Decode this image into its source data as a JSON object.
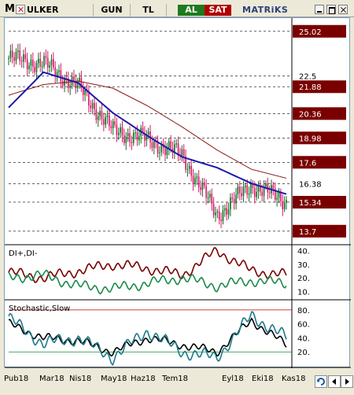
{
  "toolbar": {
    "symbol_prefix": "M",
    "symbol": "ULKER",
    "period": "GUN",
    "currency": "TL",
    "buy_label": "AL",
    "sell_label": "SAT",
    "brand": "MATRiKS"
  },
  "colors": {
    "price_tag_bg": "#7a0000",
    "candle_up": "#0a6e1e",
    "candle_down": "#e0106a",
    "ma_short": "#1a1aa8",
    "ma_long": "#8b1a1a",
    "di_plus": "#7a0000",
    "di_minus": "#1a8a4a",
    "stoch_k": "#1a7a8a",
    "stoch_d": "#000000",
    "buy": "#1e7a1e",
    "sell": "#b00000"
  },
  "price_panel": {
    "levels": [
      {
        "label": "25.02",
        "tag": true
      },
      {
        "label": "22.5",
        "tag": false
      },
      {
        "label": "21.88",
        "tag": true
      },
      {
        "label": "20.36",
        "tag": true
      },
      {
        "label": "18.98",
        "tag": true
      },
      {
        "label": "17.6",
        "tag": true
      },
      {
        "label": "16.38",
        "tag": false
      },
      {
        "label": "15.34",
        "tag": true
      },
      {
        "label": "13.7",
        "tag": true
      }
    ]
  },
  "di_panel": {
    "title": "DI+,DI-",
    "ticks": [
      "40.",
      "30.",
      "20.",
      "10."
    ]
  },
  "stoch_panel": {
    "title": "Stochastic,Slow",
    "ticks": [
      "80.",
      "60.",
      "40.",
      "20."
    ]
  },
  "x_axis": {
    "labels": [
      "Pub18",
      "Mar18",
      "Nis18",
      "May18",
      "Haz18",
      "Tem18",
      "Eyl18",
      "Eki18",
      "Kas18"
    ]
  },
  "chart_data": [
    {
      "type": "line",
      "panel": "price",
      "ylim": [
        13.2,
        25.5
      ],
      "x": [
        "Pub18",
        "Mar18",
        "Nis18",
        "May18",
        "Haz18",
        "Tem18",
        "Eyl18",
        "Eki18",
        "Kas18"
      ],
      "series": [
        {
          "name": "",
          "values": [
            23.5,
            23.2,
            21.9,
            19.4,
            18.9,
            18.0,
            14.6,
            16.3,
            15.4
          ]
        },
        {
          "name": "",
          "values": [
            20.7,
            22.7,
            22.1,
            20.4,
            19.1,
            17.9,
            17.3,
            16.4,
            15.8
          ]
        },
        {
          "name": "",
          "values": [
            21.4,
            22.0,
            22.2,
            21.8,
            20.8,
            19.6,
            18.3,
            17.2,
            16.7
          ]
        }
      ]
    },
    {
      "type": "line",
      "panel": "di",
      "ylim": [
        5,
        42
      ],
      "x": [
        "Pub18",
        "Mar18",
        "Nis18",
        "May18",
        "Haz18",
        "Tem18",
        "Eyl18",
        "Eki18",
        "Kas18"
      ],
      "series": [
        {
          "name": "DI+",
          "values": [
            24,
            20,
            25,
            30,
            27,
            22,
            40,
            25,
            22
          ]
        },
        {
          "name": "DI-",
          "values": [
            20,
            22,
            14,
            12,
            16,
            20,
            14,
            18,
            16
          ]
        }
      ]
    },
    {
      "type": "line",
      "panel": "stochastic",
      "ylim": [
        0,
        90
      ],
      "x": [
        "Pub18",
        "Mar18",
        "Nis18",
        "May18",
        "Haz18",
        "Tem18",
        "Eyl18",
        "Eki18",
        "Kas18"
      ],
      "series": [
        {
          "name": "",
          "values": [
            68,
            32,
            40,
            12,
            50,
            20,
            12,
            72,
            40
          ]
        },
        {
          "name": "",
          "values": [
            60,
            40,
            36,
            20,
            40,
            30,
            20,
            65,
            30
          ]
        }
      ]
    }
  ]
}
